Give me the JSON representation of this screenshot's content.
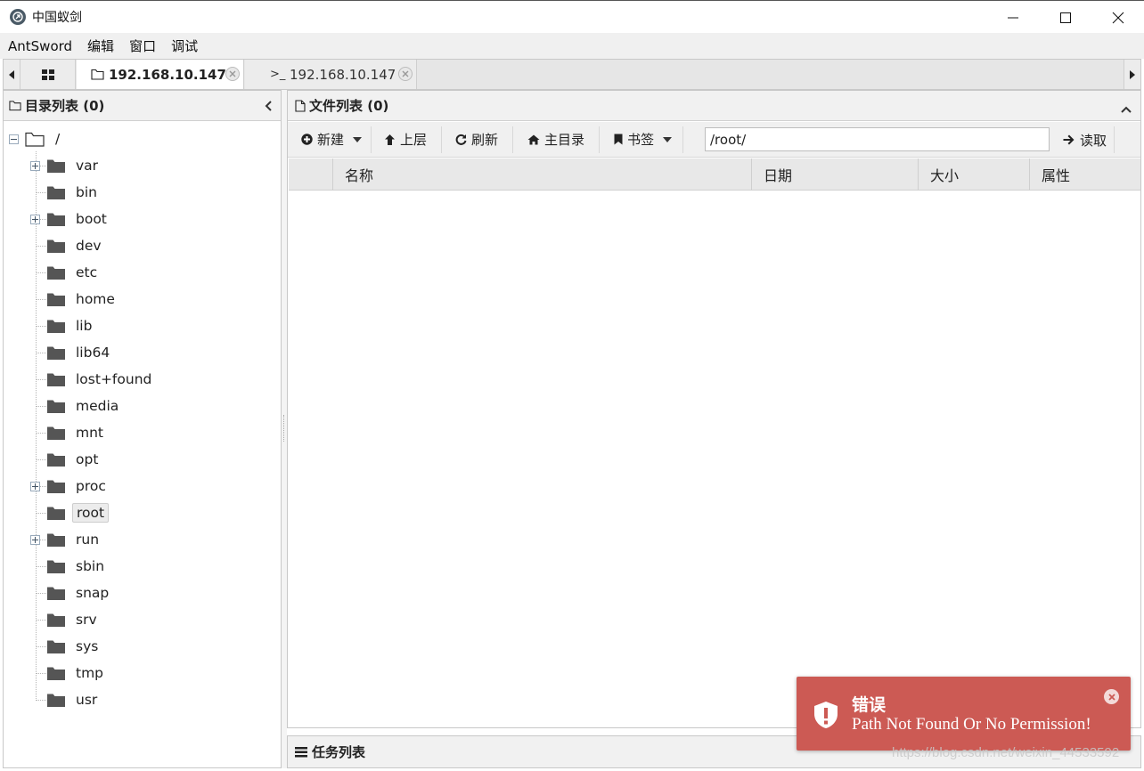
{
  "window": {
    "title": "中国蚁剑",
    "controls": [
      "minimize-icon",
      "maximize-icon",
      "close-icon"
    ]
  },
  "menu": [
    "AntSword",
    "编辑",
    "窗口",
    "调试"
  ],
  "tabs": [
    {
      "label": "192.168.10.147",
      "icon": "folder-icon",
      "active": true
    },
    {
      "label": "192.168.10.147",
      "icon": "terminal-icon",
      "active": false
    }
  ],
  "left_panel": {
    "title": "目录列表 (0)",
    "root": "/",
    "folders": [
      {
        "name": "var",
        "expandable": true,
        "selected": false
      },
      {
        "name": "bin",
        "expandable": false,
        "selected": false
      },
      {
        "name": "boot",
        "expandable": true,
        "selected": false
      },
      {
        "name": "dev",
        "expandable": false,
        "selected": false
      },
      {
        "name": "etc",
        "expandable": false,
        "selected": false
      },
      {
        "name": "home",
        "expandable": false,
        "selected": false
      },
      {
        "name": "lib",
        "expandable": false,
        "selected": false
      },
      {
        "name": "lib64",
        "expandable": false,
        "selected": false
      },
      {
        "name": "lost+found",
        "expandable": false,
        "selected": false
      },
      {
        "name": "media",
        "expandable": false,
        "selected": false
      },
      {
        "name": "mnt",
        "expandable": false,
        "selected": false
      },
      {
        "name": "opt",
        "expandable": false,
        "selected": false
      },
      {
        "name": "proc",
        "expandable": true,
        "selected": false
      },
      {
        "name": "root",
        "expandable": false,
        "selected": true
      },
      {
        "name": "run",
        "expandable": true,
        "selected": false
      },
      {
        "name": "sbin",
        "expandable": false,
        "selected": false
      },
      {
        "name": "snap",
        "expandable": false,
        "selected": false
      },
      {
        "name": "srv",
        "expandable": false,
        "selected": false
      },
      {
        "name": "sys",
        "expandable": false,
        "selected": false
      },
      {
        "name": "tmp",
        "expandable": false,
        "selected": false
      },
      {
        "name": "usr",
        "expandable": false,
        "selected": false
      }
    ]
  },
  "right_panel": {
    "title": "文件列表 (0)",
    "toolbar": {
      "new_label": "新建",
      "up_label": "上层",
      "refresh_label": "刷新",
      "home_label": "主目录",
      "bookmark_label": "书签",
      "path_value": "/root/",
      "read_label": "读取"
    },
    "columns": [
      "",
      "名称",
      "日期",
      "大小",
      "属性"
    ]
  },
  "task_panel": {
    "title": "任务列表"
  },
  "toast": {
    "title": "错误",
    "message": "Path Not Found Or No Permission!",
    "color": "#cc5a54"
  },
  "watermark": "https://blog.csdn.net/weixin_44533592"
}
